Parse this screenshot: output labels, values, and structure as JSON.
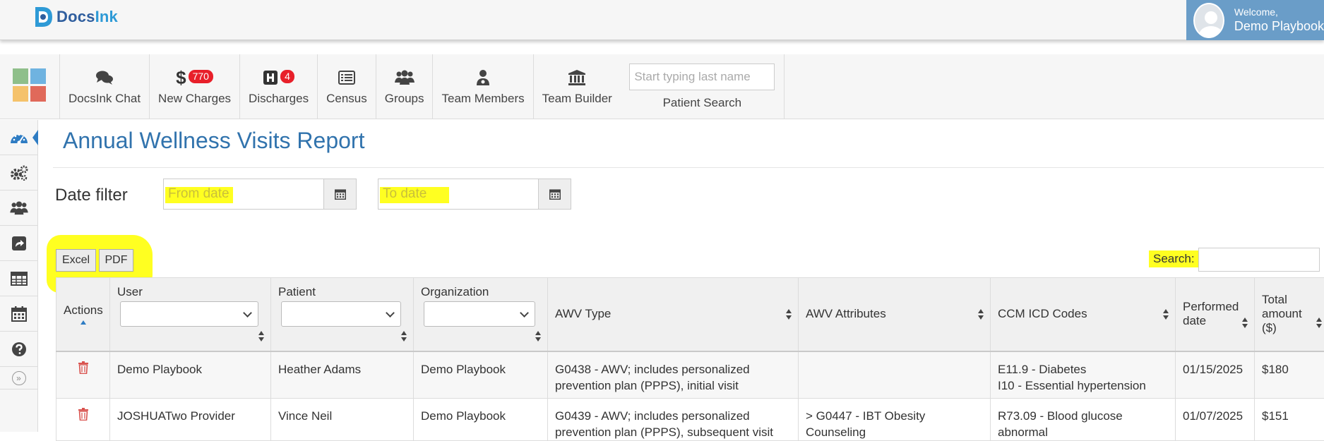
{
  "app": {
    "logo_text_a": "Docs",
    "logo_text_b": "Ink"
  },
  "user": {
    "welcome": "Welcome,",
    "name": "Demo Playbook"
  },
  "nav": {
    "items": [
      {
        "label": "DocsInk Chat",
        "icon": "chat-icon"
      },
      {
        "label": "New Charges",
        "icon": "dollar-icon",
        "badge": "770"
      },
      {
        "label": "Discharges",
        "icon": "hospital-icon",
        "badge": "4"
      },
      {
        "label": "Census",
        "icon": "list-icon"
      },
      {
        "label": "Groups",
        "icon": "users-icon"
      },
      {
        "label": "Team Members",
        "icon": "user-md-icon"
      },
      {
        "label": "Team Builder",
        "icon": "institution-icon"
      }
    ],
    "patient_search": {
      "placeholder": "Start typing last name",
      "label": "Patient Search"
    }
  },
  "sidebar": {
    "items": [
      "dashboard-icon",
      "cogs-icon",
      "users-icon",
      "share-icon",
      "table-icon",
      "calendar-icon",
      "help-icon",
      "expand-icon"
    ]
  },
  "page": {
    "title": "Annual Wellness Visits Report",
    "date_filter_label": "Date filter",
    "from_placeholder": "From date",
    "to_placeholder": "To date",
    "export": {
      "excel": "Excel",
      "pdf": "PDF"
    },
    "search_label": "Search:"
  },
  "table": {
    "columns": {
      "actions": "Actions",
      "user": "User",
      "patient": "Patient",
      "organization": "Organization",
      "awv_type": "AWV Type",
      "awv_attributes": "AWV Attributes",
      "ccm_icd": "CCM ICD Codes",
      "performed_1": "Performed",
      "performed_2": "date",
      "total_1": "Total",
      "total_2": "amount",
      "total_3": "($)"
    },
    "rows": [
      {
        "user": "Demo Playbook",
        "patient": "Heather Adams",
        "organization": "Demo Playbook",
        "awv_1": "G0438 - AWV; includes personalized",
        "awv_2": "prevention plan (PPPS), initial visit",
        "attributes": "",
        "icd_1": "E11.9 - Diabetes",
        "icd_2": "I10 - Essential hypertension",
        "performed": "01/15/2025",
        "total": "$180"
      },
      {
        "user": "JOSHUATwo Provider",
        "patient": "Vince Neil",
        "organization": "Demo Playbook",
        "awv_1": "G0439 - AWV; includes personalized",
        "awv_2": "prevention plan (PPPS), subsequent visit",
        "attributes": "> G0447 - IBT Obesity Counseling",
        "icd_1": "R73.09 - Blood glucose",
        "icd_2": "abnormal",
        "performed": "01/07/2025",
        "total": "$151"
      }
    ]
  },
  "colors": {
    "brand": "#2e7cc3",
    "welcome_bg": "#6a9dc8",
    "highlight": "#ffff21",
    "badge": "#e8202a",
    "trash": "#d9534f"
  }
}
